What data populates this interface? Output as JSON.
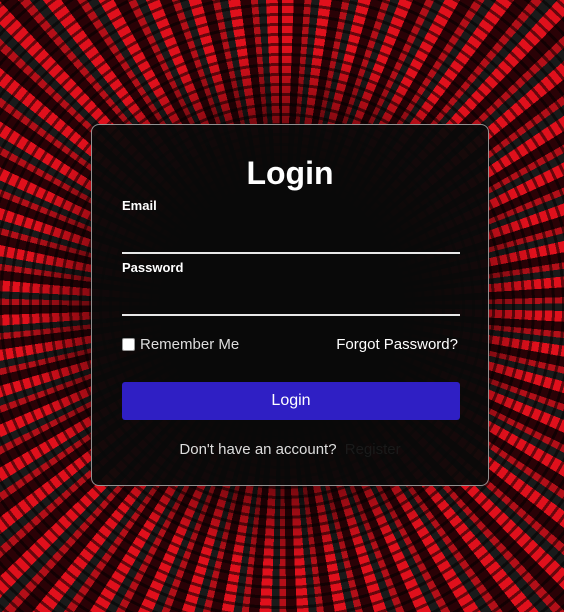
{
  "login_form": {
    "title": "Login",
    "email_label": "Email",
    "email_value": "",
    "password_label": "Password",
    "password_value": "",
    "remember_label": "Remember Me",
    "remember_checked": false,
    "forgot_label": "Forgot Password?",
    "submit_label": "Login",
    "register_prompt": "Don't have an account?",
    "register_link": "Register"
  },
  "colors": {
    "button": "#2f1fc4",
    "background_accent": "#e0101c"
  }
}
